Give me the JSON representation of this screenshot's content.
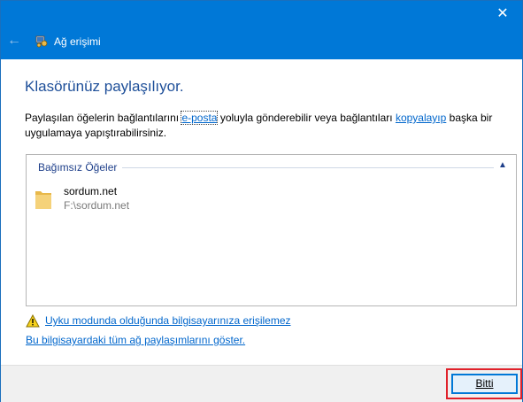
{
  "window": {
    "title": "Ağ erişimi",
    "close_label": "✕",
    "back_label": "←",
    "accent_color": "#0078d7"
  },
  "main": {
    "heading": "Klasörünüz paylaşılıyor.",
    "description": {
      "part1": "Paylaşılan öğelerin bağlantılarını ",
      "email_link": "e-posta",
      "part2": " yoluyla gönderebilir veya bağlantıları ",
      "copy_link": "kopyalayıp",
      "part3": " başka bir uygulamaya yapıştırabilirsiniz."
    },
    "items_group": {
      "label": "Bağımsız Öğeler",
      "collapse_icon": "chevron-up-icon",
      "items": [
        {
          "name": "sordum.net",
          "path": "F:\\sordum.net",
          "icon": "folder-icon"
        }
      ]
    },
    "warning_link": "Uyku modunda olduğunda bilgisayarınıza erişilemez",
    "show_all_link": "Bu bilgisayardaki tüm ağ paylaşımlarını göster."
  },
  "footer": {
    "done_button": "Bitti",
    "highlight_color": "#e0212a"
  }
}
